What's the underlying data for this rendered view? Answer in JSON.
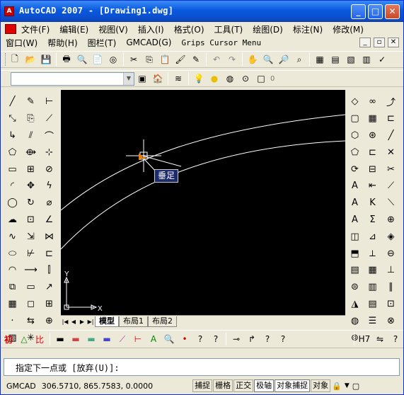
{
  "window": {
    "title": "AutoCAD 2007 - [Drawing1.dwg]",
    "app_icon_label": "A"
  },
  "menu1": [
    "文件(F)",
    "编辑(E)",
    "视图(V)",
    "插入(I)",
    "格式(O)",
    "工具(T)",
    "绘图(D)",
    "标注(N)",
    "修改(M)"
  ],
  "menu2": [
    "窗口(W)",
    "帮助(H)",
    "图栏(T)",
    "GMCAD(G)",
    "Grips Cursor Menu"
  ],
  "layer": {
    "current_value": "0"
  },
  "drawing": {
    "tooltip": "垂足",
    "ucs_x": "X",
    "ucs_y": "Y",
    "bg_color": "#000000",
    "curve_color": "#ffffff"
  },
  "tabs": [
    "模型",
    "布局1",
    "布局2"
  ],
  "cmdline": {
    "prompt": "指定下一点或 [放弃(U)]:"
  },
  "status": {
    "app_label": "GMCAD",
    "coordinates": "306.5710, 865.7583, 0.0000",
    "toggles": [
      "捕捉",
      "栅格",
      "正交",
      "极轴",
      "对象捕捉",
      "对象"
    ]
  },
  "draw_buttons": [
    "初",
    "比"
  ]
}
